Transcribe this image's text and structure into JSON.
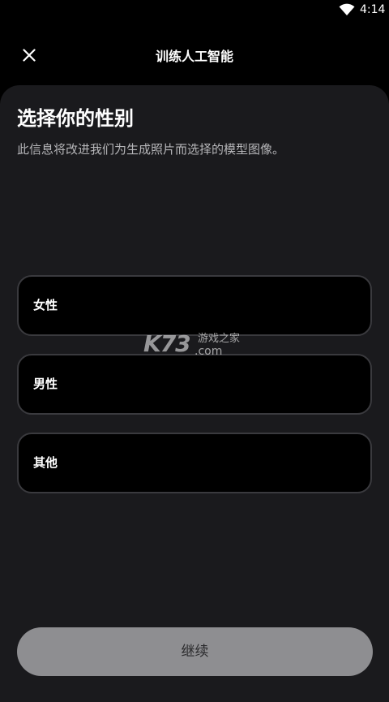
{
  "status_bar": {
    "time": "4:14",
    "wifi_icon": "wifi-icon"
  },
  "header": {
    "close_icon": "close-icon",
    "title": "训练人工智能"
  },
  "main": {
    "heading": "选择你的性别",
    "subtext": "此信息将改进我们为生成照片而选择的模型图像。",
    "options": [
      {
        "label": "女性"
      },
      {
        "label": "男性"
      },
      {
        "label": "其他"
      }
    ]
  },
  "watermark": {
    "brand": "K73",
    "cn_text": "游戏之家",
    "domain": ".com"
  },
  "footer": {
    "continue_label": "继续"
  },
  "colors": {
    "background": "#000000",
    "sheet": "#1a1a1d",
    "option_border": "#3a3a3e",
    "button_disabled": "#8e8e91"
  }
}
